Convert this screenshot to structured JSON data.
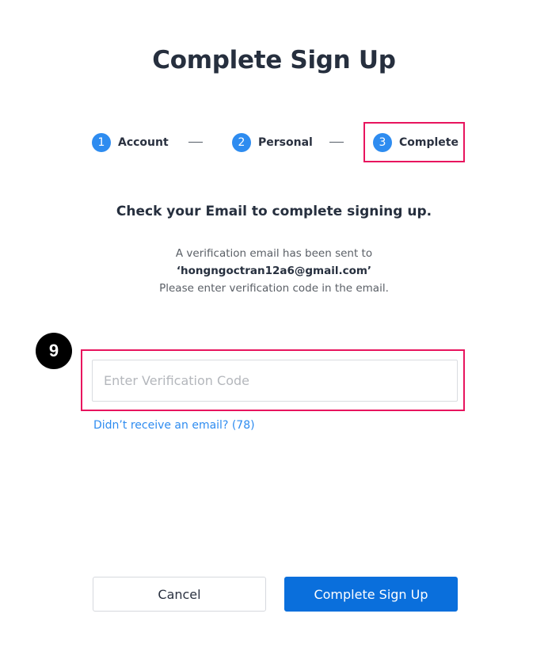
{
  "header": {
    "title": "Complete Sign Up"
  },
  "stepper": {
    "steps": [
      {
        "number": "1",
        "label": "Account"
      },
      {
        "number": "2",
        "label": "Personal"
      },
      {
        "number": "3",
        "label": "Complete"
      }
    ],
    "active_step": 3
  },
  "content": {
    "subtitle": "Check your Email to complete signing up.",
    "info_line1": "A verification email has been sent to",
    "email": "‘hongngoctran12a6@gmail.com’",
    "info_line3": "Please enter verification code in the email."
  },
  "verification": {
    "placeholder": "Enter Verification Code",
    "value": "",
    "resend_link": "Didn’t receive an email? (78)"
  },
  "annotation": {
    "step_badge": "9",
    "highlight_color": "#e8145e"
  },
  "actions": {
    "cancel_label": "Cancel",
    "submit_label": "Complete Sign Up"
  },
  "colors": {
    "accent": "#2e8cf0",
    "primary_button": "#0a6fdc"
  }
}
